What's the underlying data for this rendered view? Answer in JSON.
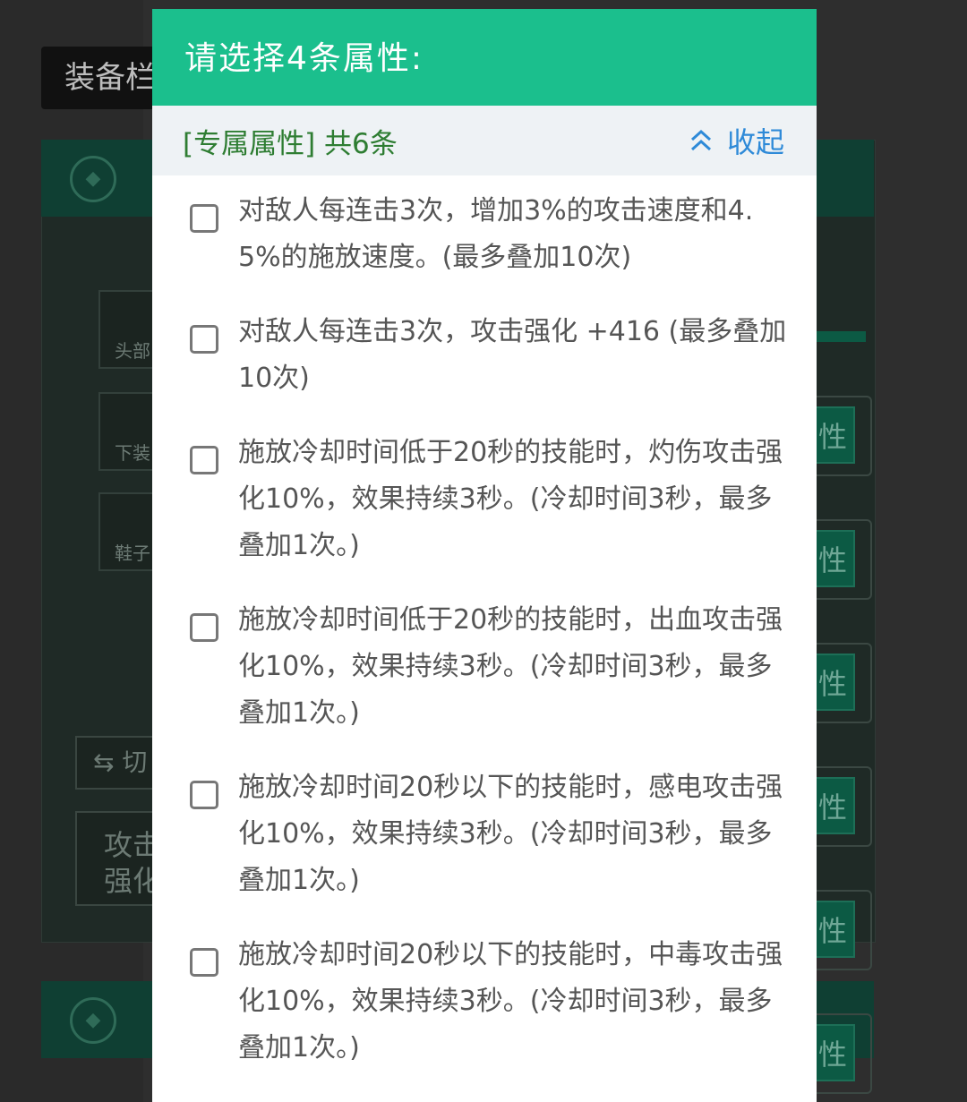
{
  "background": {
    "top_button_label": "装备栏",
    "slots": [
      "头部",
      "下装",
      "鞋子"
    ],
    "switch_label": "⇆ 切",
    "card_label": "攻击强化",
    "right_button_glyph": "性"
  },
  "dialog": {
    "title": "请选择4条属性:",
    "section_label": "[专属属性] 共6条",
    "collapse_label": "收起",
    "collapse_icon": "chevron-up-double-icon",
    "accent_color": "#1bbf8d",
    "options": [
      {
        "label": "对敌人每连击3次，增加3%的攻击速度和4.5%的施放速度。(最多叠加10次)",
        "checked": false
      },
      {
        "label": "对敌人每连击3次，攻击强化 +416 (最多叠加10次)",
        "checked": false
      },
      {
        "label": "施放冷却时间低于20秒的技能时，灼伤攻击强化10%，效果持续3秒。(冷却时间3秒，最多叠加1次。)",
        "checked": false
      },
      {
        "label": "施放冷却时间低于20秒的技能时，出血攻击强化10%，效果持续3秒。(冷却时间3秒，最多叠加1次。)",
        "checked": false
      },
      {
        "label": "施放冷却时间20秒以下的技能时，感电攻击强化10%，效果持续3秒。(冷却时间3秒，最多叠加1次。)",
        "checked": false
      },
      {
        "label": "施放冷却时间20秒以下的技能时，中毒攻击强化10%，效果持续3秒。(冷却时间3秒，最多叠加1次。)",
        "checked": false
      }
    ]
  }
}
